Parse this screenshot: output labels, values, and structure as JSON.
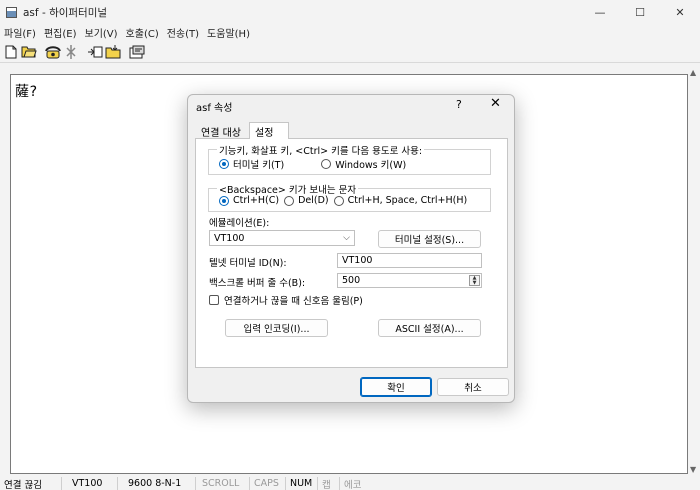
{
  "window": {
    "title": "asf - 하이퍼터미널",
    "minimize_glyph": "—",
    "maximize_glyph": "☐",
    "close_glyph": "✕"
  },
  "menu": {
    "items": [
      {
        "label": "파일(F)"
      },
      {
        "label": "편집(E)"
      },
      {
        "label": "보기(V)"
      },
      {
        "label": "호출(C)"
      },
      {
        "label": "전송(T)"
      },
      {
        "label": "도움말(H)"
      }
    ]
  },
  "toolbar": {
    "icons": [
      "new-file-icon",
      "open-folder-icon",
      "call-icon",
      "disconnect-icon",
      "send-icon",
      "receive-icon",
      "properties-icon"
    ]
  },
  "terminal": {
    "text": "薩?"
  },
  "dialog": {
    "title": "asf 속성",
    "help_glyph": "?",
    "close_glyph": "✕",
    "tabs": [
      {
        "label": "연결 대상",
        "active": false
      },
      {
        "label": "설정",
        "active": true
      }
    ],
    "function_keys": {
      "legend": "기능키, 화살표 키, <Ctrl> 키를 다음 용도로 사용:",
      "options": [
        {
          "label": "터미널 키(T)",
          "checked": true
        },
        {
          "label": "Windows 키(W)",
          "checked": false
        }
      ]
    },
    "backspace": {
      "legend": "<Backspace> 키가 보내는 문자",
      "options": [
        {
          "label": "Ctrl+H(C)",
          "checked": true
        },
        {
          "label": "Del(D)",
          "checked": false
        },
        {
          "label": "Ctrl+H, Space, Ctrl+H(H)",
          "checked": false
        }
      ]
    },
    "emulation": {
      "label": "에뮬레이션(E):",
      "value": "VT100",
      "chevron": "⌵",
      "settings_button": "터미널 설정(S)..."
    },
    "telnet_id": {
      "label": "텔넷 터미널 ID(N):",
      "value": "VT100"
    },
    "backscroll": {
      "label": "백스크롤 버퍼 줄 수(B):",
      "value": "500"
    },
    "beep": {
      "label": "연결하거나 끊을 때 신호음 울림(P)",
      "checked": false
    },
    "input_encoding_button": "입력 인코딩(I)...",
    "ascii_settings_button": "ASCII 설정(A)...",
    "ok_button": "확인",
    "cancel_button": "취소"
  },
  "statusbar": {
    "cells": [
      {
        "text": "연결 끊김",
        "dim": false
      },
      {
        "text": "VT100",
        "dim": false
      },
      {
        "text": "9600 8-N-1",
        "dim": false
      },
      {
        "text": "SCROLL",
        "dim": true
      },
      {
        "text": "CAPS",
        "dim": true
      },
      {
        "text": "NUM",
        "dim": false
      },
      {
        "text": "캡",
        "dim": true
      },
      {
        "text": "에코",
        "dim": true
      }
    ]
  },
  "colors": {
    "accent": "#0067c0",
    "window_bg": "#f3f3f3",
    "terminal_bg": "#ffffff"
  }
}
